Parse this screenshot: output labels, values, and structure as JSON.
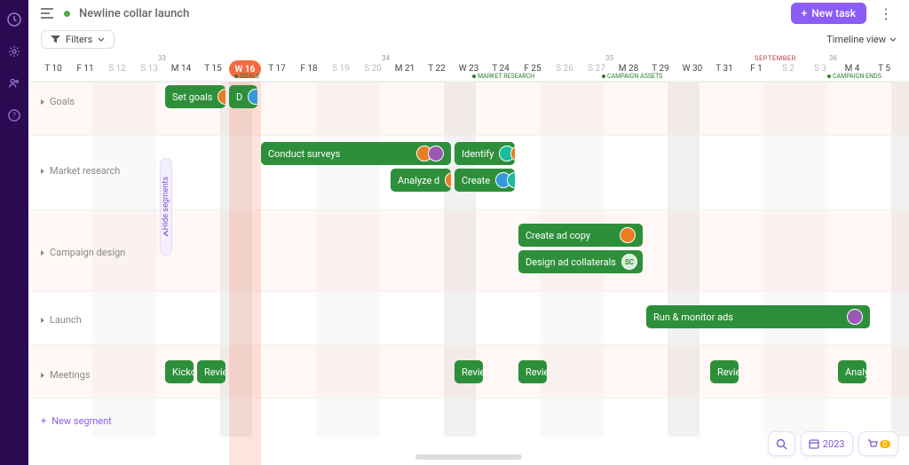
{
  "header": {
    "title": "Newline collar launch",
    "new_task": "New task",
    "filters": "Filters",
    "timeline_view": "Timeline view"
  },
  "segments": {
    "goals": "Goals",
    "market_research": "Market research",
    "campaign_design": "Campaign design",
    "launch": "Launch",
    "meetings": "Meetings",
    "new_segment": "New segment",
    "hide_segments": "Hide segments"
  },
  "timeline": {
    "month_label": "SEPTEMBER",
    "today_label": "W 16",
    "week_numbers": {
      "w33": "33",
      "w34": "34",
      "w35": "35",
      "w36": "36"
    },
    "days": [
      {
        "k": "d0",
        "l": "T 10",
        "g": false
      },
      {
        "k": "d1",
        "l": "F 11",
        "g": false
      },
      {
        "k": "d2",
        "l": "S 12",
        "g": true
      },
      {
        "k": "d3",
        "l": "S 13",
        "g": true
      },
      {
        "k": "d4",
        "l": "M 14",
        "g": false
      },
      {
        "k": "d5",
        "l": "T 15",
        "g": false
      },
      {
        "k": "d6",
        "l": "W 16",
        "g": false
      },
      {
        "k": "d7",
        "l": "T 17",
        "g": false
      },
      {
        "k": "d8",
        "l": "F 18",
        "g": false
      },
      {
        "k": "d9",
        "l": "S 19",
        "g": true
      },
      {
        "k": "d10",
        "l": "S 20",
        "g": true
      },
      {
        "k": "d11",
        "l": "M 21",
        "g": false
      },
      {
        "k": "d12",
        "l": "T 22",
        "g": false
      },
      {
        "k": "d13",
        "l": "W 23",
        "g": false
      },
      {
        "k": "d14",
        "l": "T 24",
        "g": false
      },
      {
        "k": "d15",
        "l": "F 25",
        "g": false
      },
      {
        "k": "d16",
        "l": "S 26",
        "g": true
      },
      {
        "k": "d17",
        "l": "S 27",
        "g": true
      },
      {
        "k": "d18",
        "l": "M 28",
        "g": false
      },
      {
        "k": "d19",
        "l": "T 29",
        "g": false
      },
      {
        "k": "d20",
        "l": "W 30",
        "g": false
      },
      {
        "k": "d21",
        "l": "T 31",
        "g": false
      },
      {
        "k": "d22",
        "l": "F 1",
        "g": false
      },
      {
        "k": "d23",
        "l": "S 2",
        "g": true
      },
      {
        "k": "d24",
        "l": "S 3",
        "g": true
      },
      {
        "k": "d25",
        "l": "M 4",
        "g": false
      },
      {
        "k": "d26",
        "l": "T 5",
        "g": false
      }
    ],
    "milestones": {
      "goals": "GOALS",
      "market_research": "MARKET RESEARCH",
      "campaign_assets": "CAMPAIGN ASSETS",
      "campaign_ends": "CAMPAIGN ENDS"
    }
  },
  "tasks": {
    "set_goals": "Set goals",
    "d": "D",
    "conduct_surveys": "Conduct surveys",
    "identify": "Identify",
    "analyze": "Analyze d",
    "create": "Create",
    "create_ad_copy": "Create ad copy",
    "design_ad_collaterals": "Design ad collaterals",
    "run_monitor_ads": "Run & monitor ads",
    "kickoff": "Kicko",
    "review": "Revie",
    "analy": "Analy"
  },
  "avatars": {
    "sc": "SC"
  },
  "quickbar": {
    "year": "2023",
    "cart_count": "0"
  }
}
